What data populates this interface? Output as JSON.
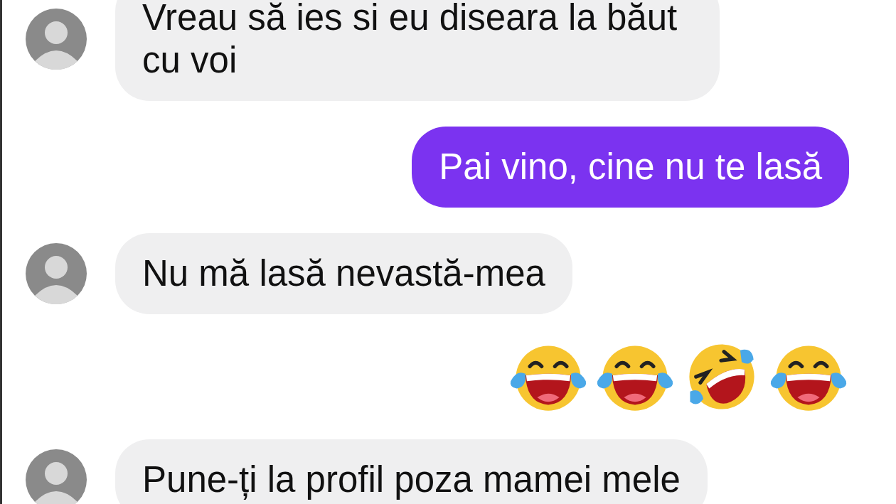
{
  "messages": [
    {
      "kind": "text",
      "outgoing": false,
      "text": "Vreau să ies si eu diseara la băut cu voi"
    },
    {
      "kind": "text",
      "outgoing": true,
      "text": "Pai vino, cine nu te lasă"
    },
    {
      "kind": "text",
      "outgoing": false,
      "text": "Nu mă lasă nevastă-mea"
    },
    {
      "kind": "emoji",
      "outgoing": true,
      "emojis": [
        {
          "kind": "tears-of-joy"
        },
        {
          "kind": "tears-of-joy"
        },
        {
          "kind": "rolling-laughing"
        },
        {
          "kind": "tears-of-joy"
        }
      ]
    },
    {
      "kind": "text",
      "outgoing": false,
      "text": "Pune-ți la profil poza mamei mele"
    }
  ]
}
